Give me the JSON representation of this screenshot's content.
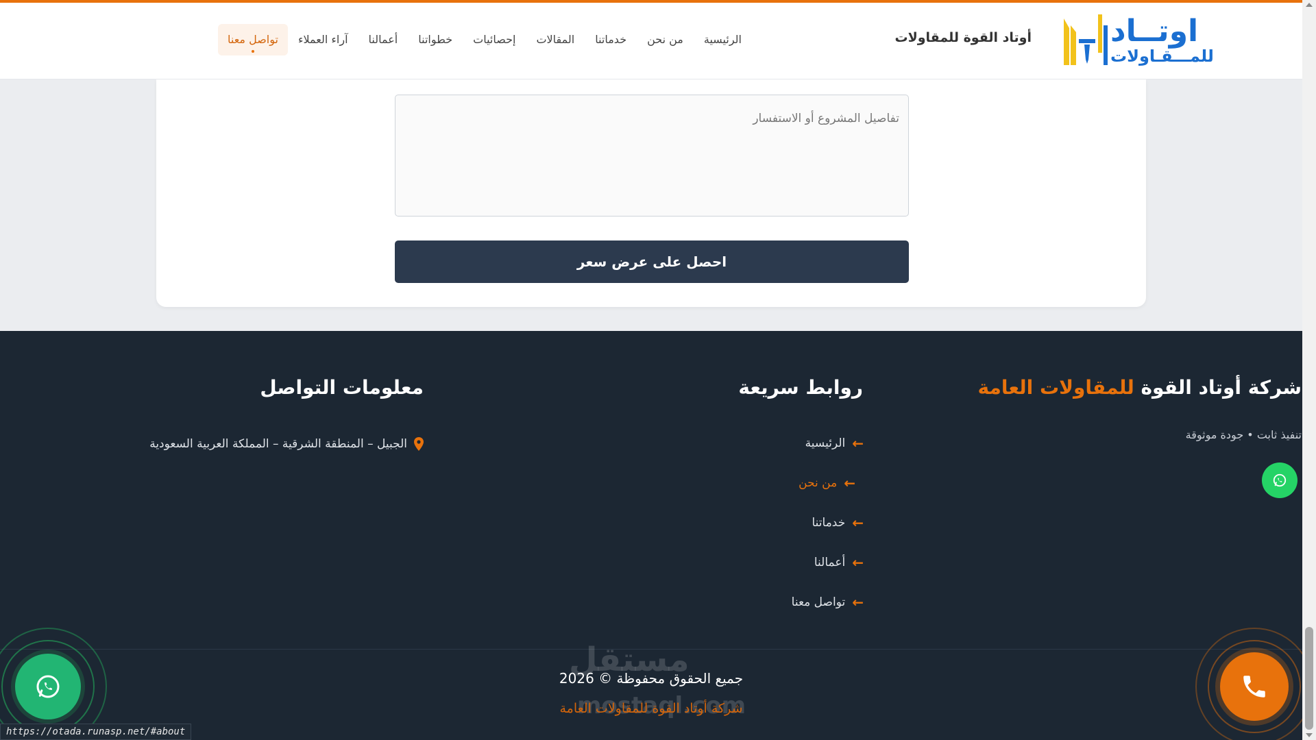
{
  "header": {
    "logo": {
      "line1": "اوتــاد",
      "line2": "للمـــقـاولات"
    },
    "brand_name": "أوتاد القوة للمقاولات",
    "nav": [
      {
        "label": "الرئيسية"
      },
      {
        "label": "من نحن"
      },
      {
        "label": "خدماتنا"
      },
      {
        "label": "المقالات"
      },
      {
        "label": "إحصائيات"
      },
      {
        "label": "خطواتنا"
      },
      {
        "label": "أعمالنا"
      },
      {
        "label": "آراء العملاء"
      },
      {
        "label": "تواصل معنا",
        "active": true
      }
    ]
  },
  "form": {
    "details_placeholder": "تفاصيل المشروع أو الاستفسار",
    "submit_label": "احصل على عرض سعر"
  },
  "footer": {
    "about": {
      "title_main": "شركة أوتاد القوة",
      "title_accent": "للمقاولات العامة",
      "tagline": "تنفيذ ثابت • جودة موثوقة"
    },
    "quick_links": {
      "title": "روابط سريعة",
      "items": [
        {
          "label": "الرئيسية"
        },
        {
          "label": "من نحن",
          "active": true
        },
        {
          "label": "خدماتنا"
        },
        {
          "label": "أعمالنا"
        },
        {
          "label": "تواصل معنا"
        }
      ]
    },
    "contact": {
      "title": "معلومات التواصل",
      "address": "الجبيل – المنطقة الشرقية – المملكة العربية السعودية"
    },
    "copyright": "جميع الحقوق محفوظة © 2026",
    "company": "شركة أوتاد القوة للمقاولات العامة",
    "watermark": "مستقل",
    "watermark_url": "mostaql.com"
  },
  "status_url": "https://otada.runasp.net/#about",
  "colors": {
    "accent": "#e8720c",
    "footer_bg": "#1c2733",
    "button_bg": "#2c3a4e",
    "whatsapp": "#25d366",
    "logo_blue": "#1b6fd1",
    "logo_yellow": "#f2c21b"
  },
  "icons": [
    "whatsapp-icon",
    "phone-icon",
    "location-pin-icon",
    "arrow-left-icon",
    "logo-mark-icon"
  ]
}
